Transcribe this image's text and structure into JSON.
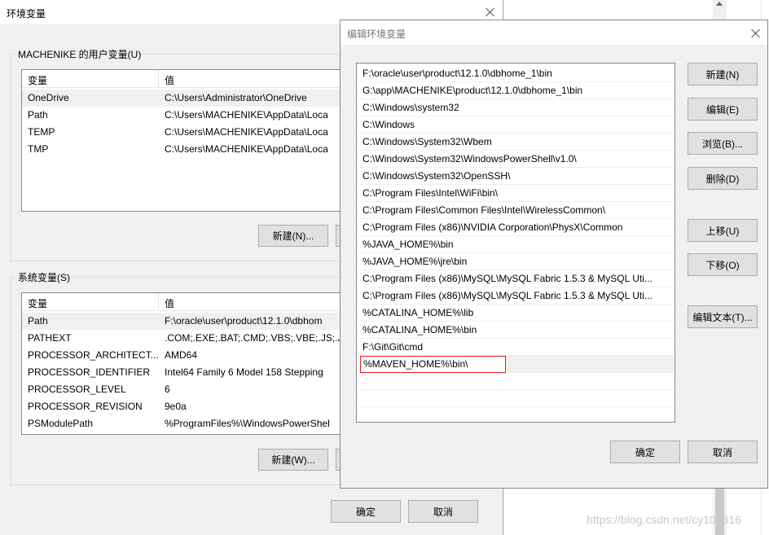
{
  "env_dialog": {
    "title": "环境变量",
    "user_group_label": "MACHENIKE 的用户变量(U)",
    "user_vars": {
      "headers": [
        "变量",
        "值"
      ],
      "rows": [
        {
          "name": "OneDrive",
          "value": "C:\\Users\\Administrator\\OneDrive"
        },
        {
          "name": "Path",
          "value": "C:\\Users\\MACHENIKE\\AppData\\Loca"
        },
        {
          "name": "TEMP",
          "value": "C:\\Users\\MACHENIKE\\AppData\\Loca"
        },
        {
          "name": "TMP",
          "value": "C:\\Users\\MACHENIKE\\AppData\\Loca"
        }
      ]
    },
    "user_new_button": "新建(N)...",
    "system_group_label": "系统变量(S)",
    "system_vars": {
      "headers": [
        "变量",
        "值"
      ],
      "rows": [
        {
          "name": "Path",
          "value": "F:\\oracle\\user\\product\\12.1.0\\dbhom"
        },
        {
          "name": "PATHEXT",
          "value": ".COM;.EXE;.BAT;.CMD;.VBS;.VBE;.JS;.JS"
        },
        {
          "name": "PROCESSOR_ARCHITECT...",
          "value": "AMD64"
        },
        {
          "name": "PROCESSOR_IDENTIFIER",
          "value": "Intel64 Family 6 Model 158 Stepping"
        },
        {
          "name": "PROCESSOR_LEVEL",
          "value": "6"
        },
        {
          "name": "PROCESSOR_REVISION",
          "value": "9e0a"
        },
        {
          "name": "PSModulePath",
          "value": "%ProgramFiles%\\WindowsPowerShel"
        }
      ]
    },
    "system_new_button": "新建(W)...",
    "ok_button": "确定",
    "cancel_button": "取消"
  },
  "edit_dialog": {
    "title": "编辑环境变量",
    "paths": [
      "F:\\oracle\\user\\product\\12.1.0\\dbhome_1\\bin",
      "G:\\app\\MACHENIKE\\product\\12.1.0\\dbhome_1\\bin",
      "C:\\Windows\\system32",
      "C:\\Windows",
      "C:\\Windows\\System32\\Wbem",
      "C:\\Windows\\System32\\WindowsPowerShell\\v1.0\\",
      "C:\\Windows\\System32\\OpenSSH\\",
      "C:\\Program Files\\Intel\\WiFi\\bin\\",
      "C:\\Program Files\\Common Files\\Intel\\WirelessCommon\\",
      "C:\\Program Files (x86)\\NVIDIA Corporation\\PhysX\\Common",
      "%JAVA_HOME%\\bin",
      "%JAVA_HOME%\\jre\\bin",
      "C:\\Program Files (x86)\\MySQL\\MySQL Fabric 1.5.3 & MySQL Uti...",
      "C:\\Program Files (x86)\\MySQL\\MySQL Fabric 1.5.3 & MySQL Uti...",
      "%CATALINA_HOME%\\lib",
      "%CATALINA_HOME%\\bin",
      "F:\\Git\\Git\\cmd",
      "%MAVEN_HOME%\\bin\\"
    ],
    "buttons": {
      "new": "新建(N)",
      "edit": "编辑(E)",
      "browse": "浏览(B)...",
      "delete": "删除(D)",
      "move_up": "上移(U)",
      "move_down": "下移(O)",
      "edit_text": "编辑文本(T)..."
    },
    "ok_button": "确定",
    "cancel_button": "取消"
  },
  "watermark": "https://blog.csdn.net/cy101816"
}
